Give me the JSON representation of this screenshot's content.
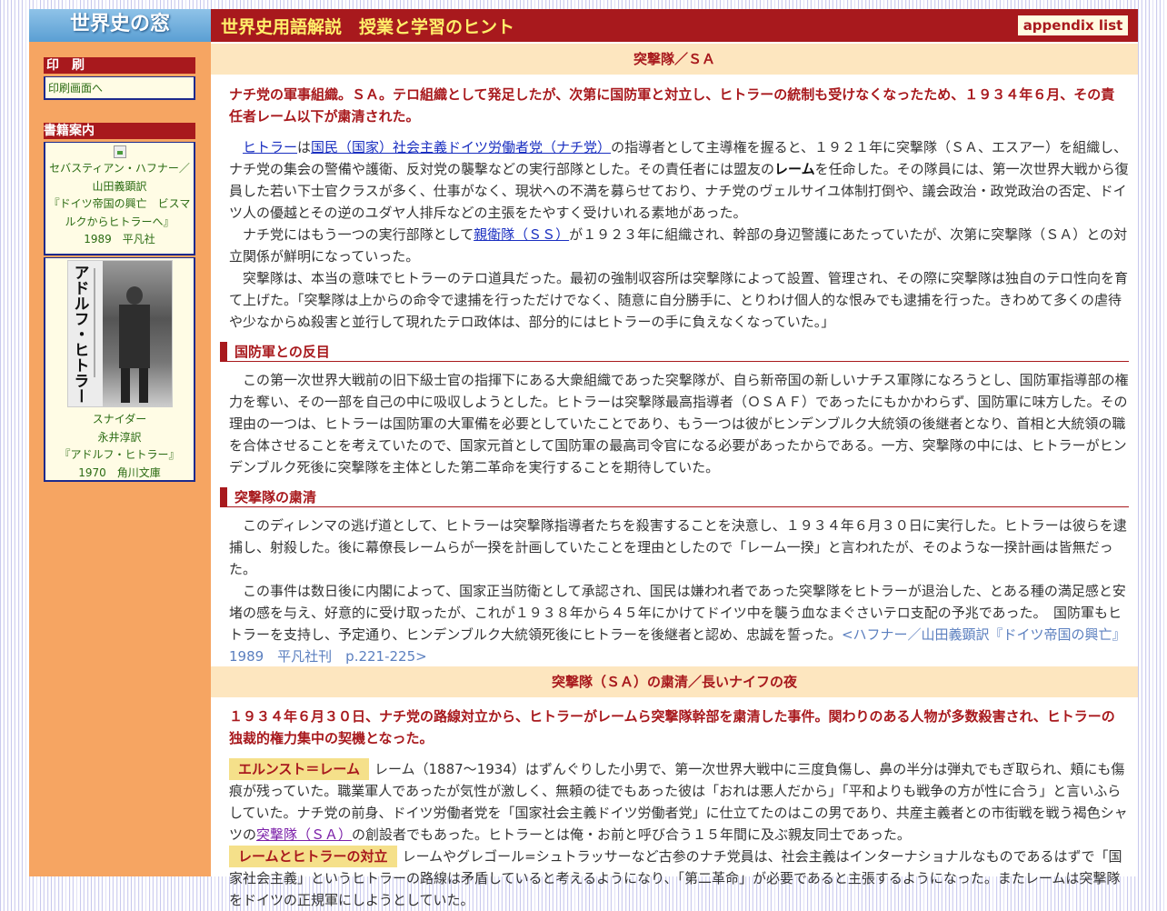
{
  "header": {
    "site_title": "世界史の窓",
    "page_title": "世界史用語解説　授業と学習のヒント",
    "appendix_label": "appendix list"
  },
  "sidebar": {
    "print_heading": "印　刷",
    "print_link": "印刷画面へ",
    "books_heading": "書籍案内",
    "book1": [
      "セバスティアン・ハフナー／",
      "山田義顕訳",
      "『ドイツ帝国の興亡　ビスマ",
      "ルクからヒトラーへ』",
      "1989　平凡社"
    ],
    "book2": [
      "スナイダー",
      "永井淳訳",
      "『アドルフ・ヒトラー』",
      "1970　角川文庫"
    ],
    "book2_cover_title": "アドルフ・ヒトラー"
  },
  "section1": {
    "title": "突撃隊／ＳＡ",
    "lead": "ナチ党の軍事組織。ＳＡ。テロ組織として発足したが、次第に国防軍と対立し、ヒトラーの統制も受けなくなったため、１９３４年６月、その責任者レーム以下が粛清された。",
    "p1_link1": "ヒトラー",
    "p1_t1": "は",
    "p1_link2": "国民（国家）社会主義ドイツ労働者党（ナチ党）",
    "p1_t2": "の指導者として主導権を握ると、１９２１年に突撃隊（ＳＡ、エスアー）を組織し、ナチ党の集会の警備や護衛、反対党の襲撃などの実行部隊とした。その責任者には盟友の",
    "p1_bold": "レーム",
    "p1_t3": "を任命した。その隊員には、第一次世界大戦から復員した若い下士官クラスが多く、仕事がなく、現状への不満を募らせており、ナチ党のヴェルサイユ体制打倒や、議会政治・政党政治の否定、ドイツ人の優越とその逆のユダヤ人排斥などの主張をたやすく受けいれる素地があった。",
    "p2_t1": "ナチ党にはもう一つの実行部隊として",
    "p2_link": "親衛隊（ＳＳ）",
    "p2_t2": "が１９２３年に組織され、幹部の身辺警護にあたっていたが、次第に突撃隊（ＳＡ）との対立関係が鮮明になっていった。",
    "p3": "突撃隊は、本当の意味でヒトラーのテロ道具だった。最初の強制収容所は突撃隊によって設置、管理され、その際に突撃隊は独自のテロ性向を育て上げた。「突撃隊は上からの命令で逮捕を行っただけでなく、随意に自分勝手に、とりわけ個人的な恨みでも逮捕を行った。きわめて多くの虐待や少なからぬ殺害と並行して現れたテロ政体は、部分的にはヒトラーの手に負えなくなっていた。」",
    "sub1": "国防軍との反目",
    "p4": "この第一次世界大戦前の旧下級士官の指揮下にある大衆組織であった突撃隊が、自ら新帝国の新しいナチス軍隊になろうとし、国防軍指導部の権力を奪い、その一部を自己の中に吸収しようとした。ヒトラーは突撃隊最高指導者（ＯＳＡＦ）であったにもかかわらず、国防軍に味方した。その理由の一つは、ヒトラーは国防軍の大軍備を必要としていたことであり、もう一つは彼がヒンデンブルク大統領の後継者となり、首相と大統領の職を合体させることを考えていたので、国家元首として国防軍の最高司令官になる必要があったからである。一方、突撃隊の中には、ヒトラーがヒンデンブルク死後に突撃隊を主体とした第二革命を実行することを期待していた。",
    "sub2": "突撃隊の粛清",
    "p5": "このディレンマの逃げ道として、ヒトラーは突撃隊指導者たちを殺害することを決意し、１９３４年６月３０日に実行した。ヒトラーは彼らを逮捕し、射殺した。後に幕僚長レームらが一揆を計画していたことを理由としたので「レーム一揆」と言われたが、そのような一揆計画は皆無だった。",
    "p6": "この事件は数日後に内閣によって、国家正当防衛として承認され、国民は嫌われ者であった突撃隊をヒトラーが退治した、とある種の満足感と安堵の感を与え、好意的に受け取ったが、これが１９３８年から４５年にかけてドイツ中を襲う血なまぐさいテロ支配の予兆であった。　国防軍もヒトラーを支持し、予定通り、ヒンデンブルク大統領死後にヒトラーを後継者と認め、忠誠を誓った。",
    "p6_cite": "<ハフナー／山田義顕訳『ドイツ帝国の興亡』1989　平凡社刊　p.221-225>"
  },
  "section2": {
    "title": "突撃隊（ＳＡ）の粛清／長いナイフの夜",
    "lead": "１９３４年６月３０日、ナチ党の路線対立から、ヒトラーがレームら突撃隊幹部を粛清した事件。関わりのある人物が多数殺害され、ヒトラーの独裁的権力集中の契機となった。",
    "tag1": "エルンスト＝レーム",
    "p1_t1": "レーム（1887～1934）はずんぐりした小男で、第一次世界大戦中に三度負傷し、鼻の半分は弾丸でもぎ取られ、頬にも傷痕が残っていた。職業軍人であったが気性が激しく、無頼の徒でもあった彼は「おれは悪人だから」「平和よりも戦争の方が性に合う」と言いふらしていた。ナチ党の前身、ドイツ労働者党を「国家社会主義ドイツ労働者党」に仕立てたのはこの男であり、共産主義者との市街戦を戦う褐色シャツの",
    "p1_link": "突撃隊（ＳＡ）",
    "p1_t2": "の創設者でもあった。ヒトラーとは俺・お前と呼び合う１５年間に及ぶ親友同士であった。",
    "tag2": "レームとヒトラーの対立",
    "p2": "レームやグレゴール=シュトラッサーなど古参のナチ党員は、社会主義はインターナショナルなものであるはずで「国家社会主義」というヒトラーの路線は矛盾していると考えるようになり、「第二革命」が必要であると主張するようになった。またレームは突撃隊をドイツの正規軍にしようとしていた。"
  }
}
